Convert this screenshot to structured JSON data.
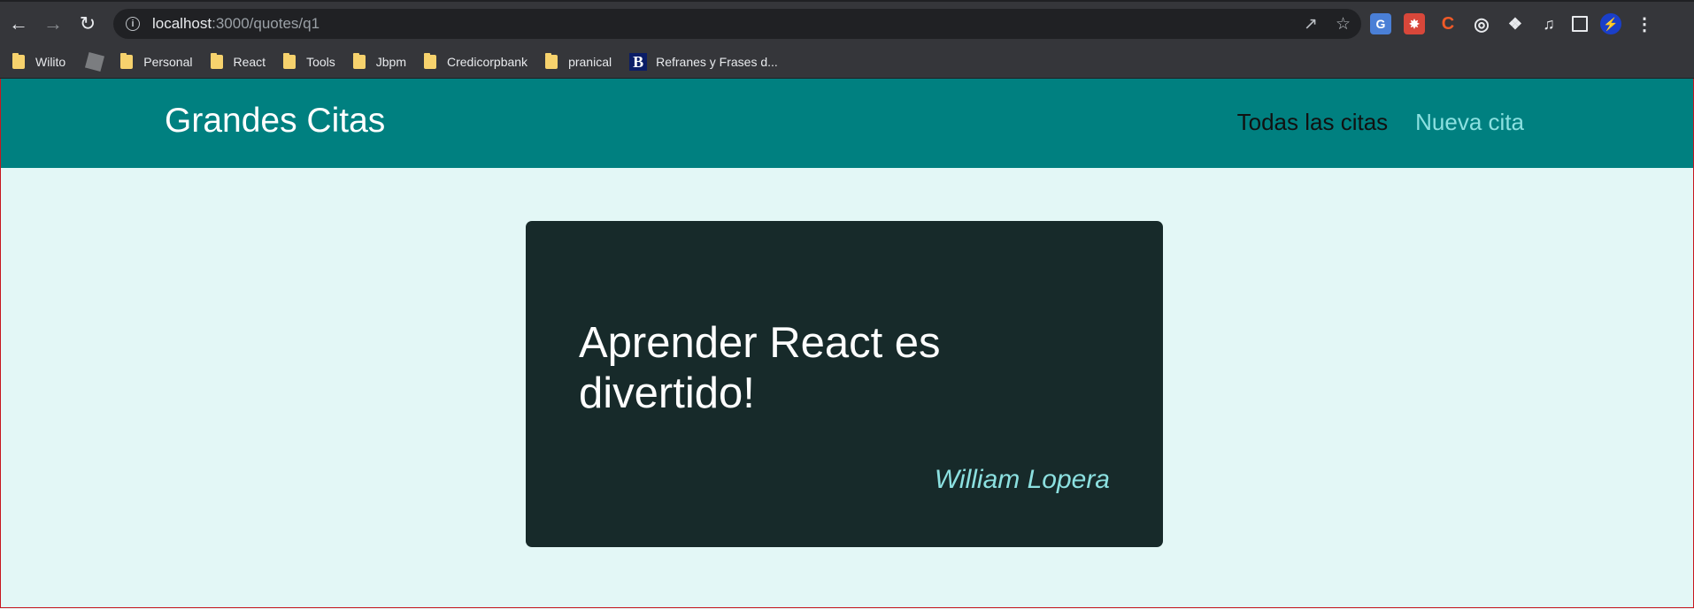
{
  "browser": {
    "url_host": "localhost",
    "url_path": ":3000/quotes/q1",
    "bookmarks": [
      {
        "label": "Wilito",
        "icon": "folder-icon"
      },
      {
        "label": "",
        "icon": "roblox-icon"
      },
      {
        "label": "Personal",
        "icon": "folder-icon"
      },
      {
        "label": "React",
        "icon": "folder-icon"
      },
      {
        "label": "Tools",
        "icon": "folder-icon"
      },
      {
        "label": "Jbpm",
        "icon": "folder-icon"
      },
      {
        "label": "Credicorpbank",
        "icon": "folder-icon"
      },
      {
        "label": "pranical",
        "icon": "folder-icon"
      },
      {
        "label": "Refranes y Frases d...",
        "icon": "b-logo-icon"
      }
    ]
  },
  "app": {
    "title": "Grandes Citas",
    "nav": {
      "all_quotes": "Todas las citas",
      "new_quote": "Nueva cita"
    }
  },
  "quote": {
    "text": "Aprender React es divertido!",
    "author": "William Lopera"
  },
  "colors": {
    "header": "#008080",
    "page_bg": "#e3f7f6",
    "card_bg": "#172a2a",
    "accent": "#8ce0e0"
  }
}
